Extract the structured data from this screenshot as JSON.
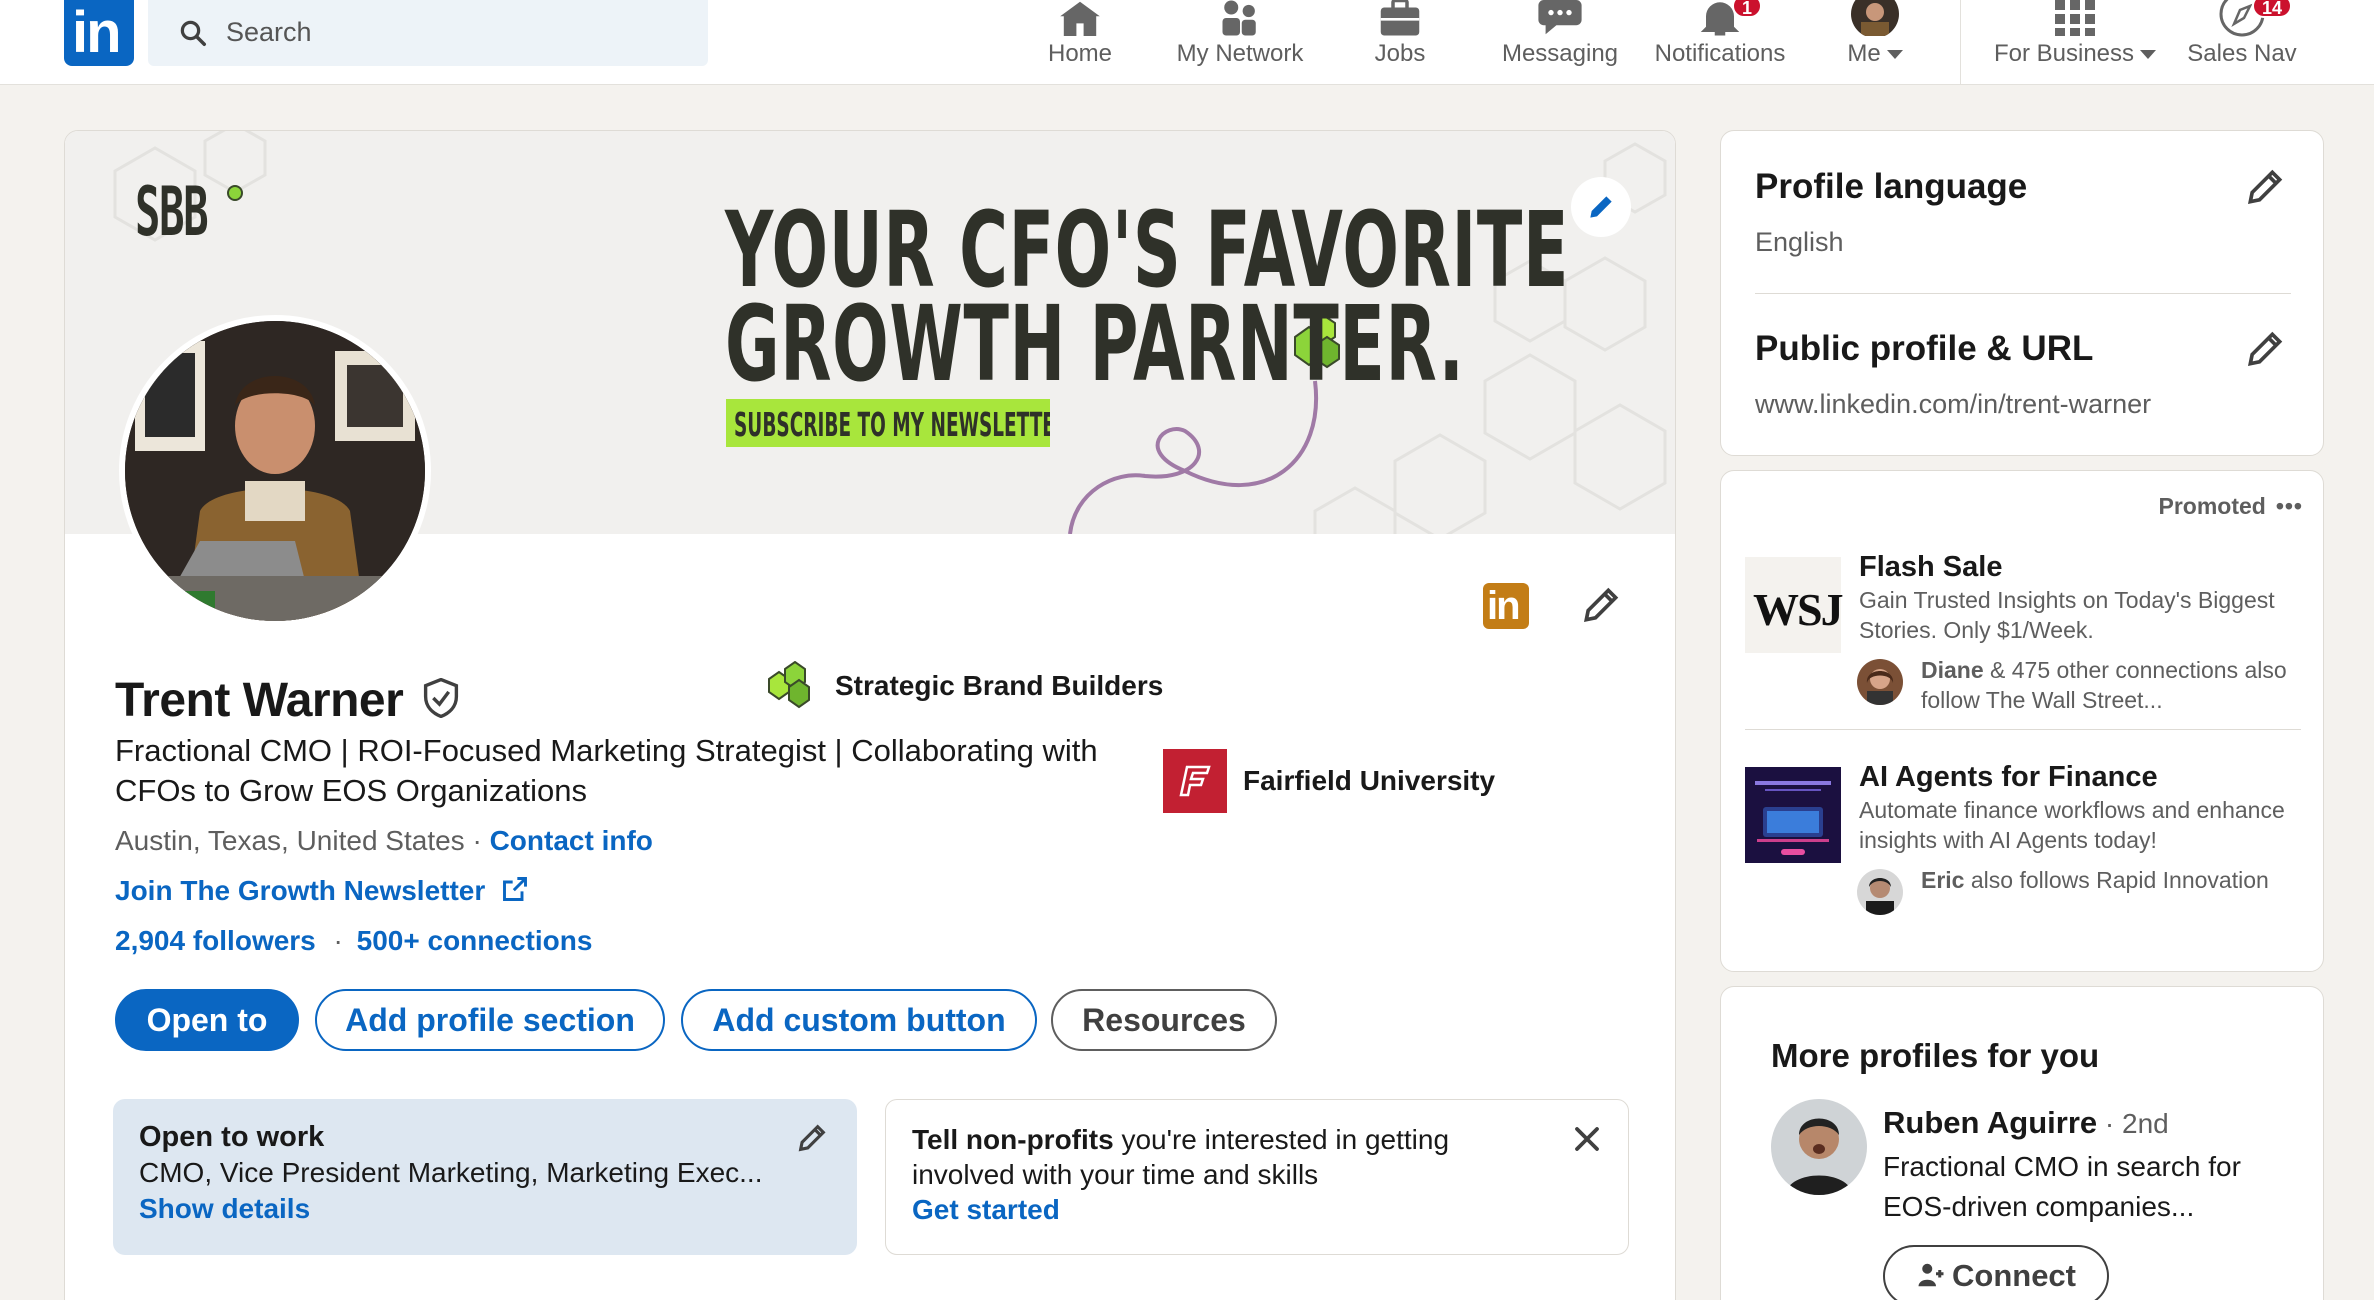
{
  "nav": {
    "search_placeholder": "Search",
    "items": [
      {
        "label": "Home",
        "icon": "home-icon"
      },
      {
        "label": "My Network",
        "icon": "network-icon"
      },
      {
        "label": "Jobs",
        "icon": "briefcase-icon"
      },
      {
        "label": "Messaging",
        "icon": "chat-icon"
      },
      {
        "label": "Notifications",
        "icon": "bell-icon",
        "badge": "1"
      },
      {
        "label": "Me",
        "icon": "avatar"
      },
      {
        "label": "For Business",
        "icon": "grid-icon"
      },
      {
        "label": "Sales Nav",
        "icon": "compass-icon",
        "badge": "14"
      }
    ],
    "colors": {
      "brand": "#0a66c2",
      "badge": "#cb112d"
    }
  },
  "banner": {
    "logo_text": "SBB",
    "line1": "YOUR CFO'S FAVORITE",
    "line2": "GROWTH PARNTER.",
    "cta": "SUBSCRIBE TO MY NEWSLETTER",
    "colors": {
      "cta_bg": "#a8e63c",
      "text": "#2f3129",
      "swirl": "#a07aa6"
    }
  },
  "profile": {
    "name": "Trent Warner",
    "headline": "Fractional CMO | ROI-Focused Marketing Strategist | Collaborating with CFOs to Grow EOS Organizations",
    "location": "Austin, Texas, United States",
    "contact_info": "Contact info",
    "newsletter_link": "Join The Growth Newsletter",
    "followers": "2,904 followers",
    "separator": "·",
    "connections": "500+ connections",
    "organizations": [
      {
        "name": "Strategic Brand Builders",
        "logo": "bee-logo-icon"
      },
      {
        "name": "Fairfield University",
        "logo": "fairfield-logo-icon"
      }
    ],
    "buttons": {
      "open_to": "Open to",
      "add_section": "Add profile section",
      "add_custom": "Add custom button",
      "resources": "Resources"
    },
    "open_to_work": {
      "title": "Open to work",
      "roles": "CMO, Vice President Marketing, Marketing Exec...",
      "show_details": "Show details"
    },
    "nonprofit": {
      "bold": "Tell non-profits",
      "text": " you're interested in getting involved with your time and skills",
      "cta": "Get started"
    }
  },
  "sidebar": {
    "profile_language": {
      "title": "Profile language",
      "value": "English"
    },
    "public_profile": {
      "title": "Public profile & URL",
      "value": "www.linkedin.com/in/trent-warner"
    },
    "promoted_label": "Promoted",
    "ads": [
      {
        "logo": "WSJ",
        "title": "Flash Sale",
        "desc": "Gain Trusted Insights on Today's Biggest Stories. Only $1/Week.",
        "social_name": "Diane",
        "social_text": " & 475 other connections also follow The Wall Street..."
      },
      {
        "title": "AI Agents for Finance",
        "desc": "Automate finance workflows and enhance insights with AI Agents today!",
        "social_name": "Eric",
        "social_text": " also follows Rapid Innovation"
      }
    ],
    "more_profiles": {
      "title": "More profiles for you",
      "person": {
        "name": "Ruben Aguirre",
        "degree": " · 2nd",
        "desc": "Fractional CMO in search for EOS-driven companies..."
      },
      "connect": "Connect"
    }
  }
}
